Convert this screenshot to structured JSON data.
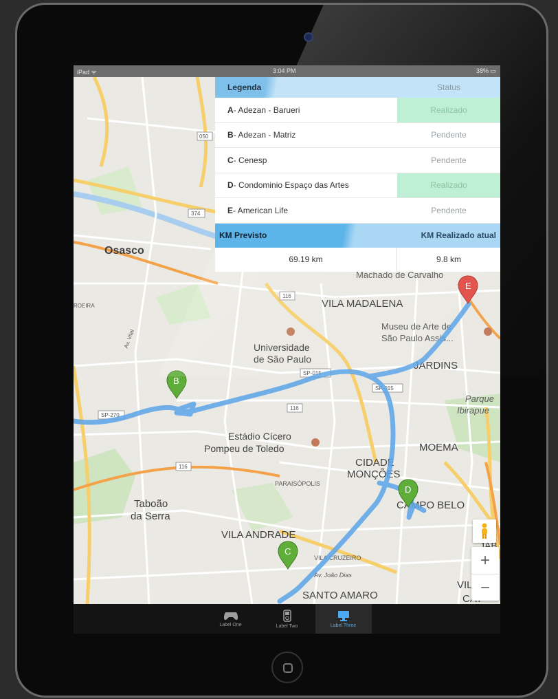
{
  "status_bar": {
    "left": "iPad ᯤ",
    "time": "3:04 PM",
    "right": "38% ▭"
  },
  "legend": {
    "header_left": "Legenda",
    "header_right": "Status",
    "rows": [
      {
        "letter": "A",
        "name": " - Adezan - Barueri",
        "status": "Realizado",
        "done": true
      },
      {
        "letter": "B",
        "name": " - Adezan - Matriz",
        "status": "Pendente",
        "done": false
      },
      {
        "letter": "C",
        "name": " - Cenesp",
        "status": "Pendente",
        "done": false
      },
      {
        "letter": "D",
        "name": " - Condominio Espaço das Artes",
        "status": "Realizado",
        "done": true
      },
      {
        "letter": "E",
        "name": " - American Life",
        "status": "Pendente",
        "done": false
      }
    ],
    "km_previsto_label": "KM Previsto",
    "km_realizado_label": "KM Realizado atual",
    "km_previsto_value": "69.19 km",
    "km_realizado_value": "9.8 km"
  },
  "map": {
    "labels": {
      "osasco": "Osasco",
      "machado": "Machado de Carvalho",
      "vila_madalena": "VILA MADALENA",
      "museu_1": "Museu de Arte de",
      "museu_2": "São Paulo Assis...",
      "usp_1": "Universidade",
      "usp_2": "de São Paulo",
      "jardins": "JARDINS",
      "parque_1": "Parque",
      "parque_2": "Ibirapue",
      "estadio_1": "Estádio Cícero",
      "estadio_2": "Pompeu de Toledo",
      "moema": "MOEMA",
      "cidade_1": "CIDADE",
      "cidade_2": "MONÇÕES",
      "paraisopolis": "PARAISÓPOLIS",
      "campo_belo": "CAMPO BELO",
      "taboao_1": "Taboão",
      "taboao_2": "da Serra",
      "vila_andrade": "VILA ANDRADE",
      "vila_cruzeiro": "VILA CRUZEIRO",
      "av_joao": "Av. João Dias",
      "santo_amaro": "SANTO AMARO",
      "vila_1": "VILA",
      "vila_2": "CAT",
      "jab": "JAB",
      "roeira": "ROEIRA",
      "av_vital": "Av. Vital",
      "route_050": "050",
      "route_374": "374",
      "route_116a": "116",
      "route_116b": "116",
      "route_116c": "116",
      "route_sp270": "SP-270",
      "route_sp015a": "SP-015",
      "route_sp015b": "SP-015"
    },
    "markers": [
      "B",
      "C",
      "D",
      "E"
    ],
    "marker_colors": {
      "green": "#5fae3a",
      "red": "#e0514a"
    },
    "route_color": "#5aa3e8",
    "zoom_in": "+",
    "zoom_out": "−"
  },
  "tabs": [
    {
      "label": "Label One",
      "icon": "gamepad-icon",
      "active": false
    },
    {
      "label": "Label Two",
      "icon": "ipod-icon",
      "active": false
    },
    {
      "label": "Label Three",
      "icon": "monitor-icon",
      "active": true
    }
  ]
}
